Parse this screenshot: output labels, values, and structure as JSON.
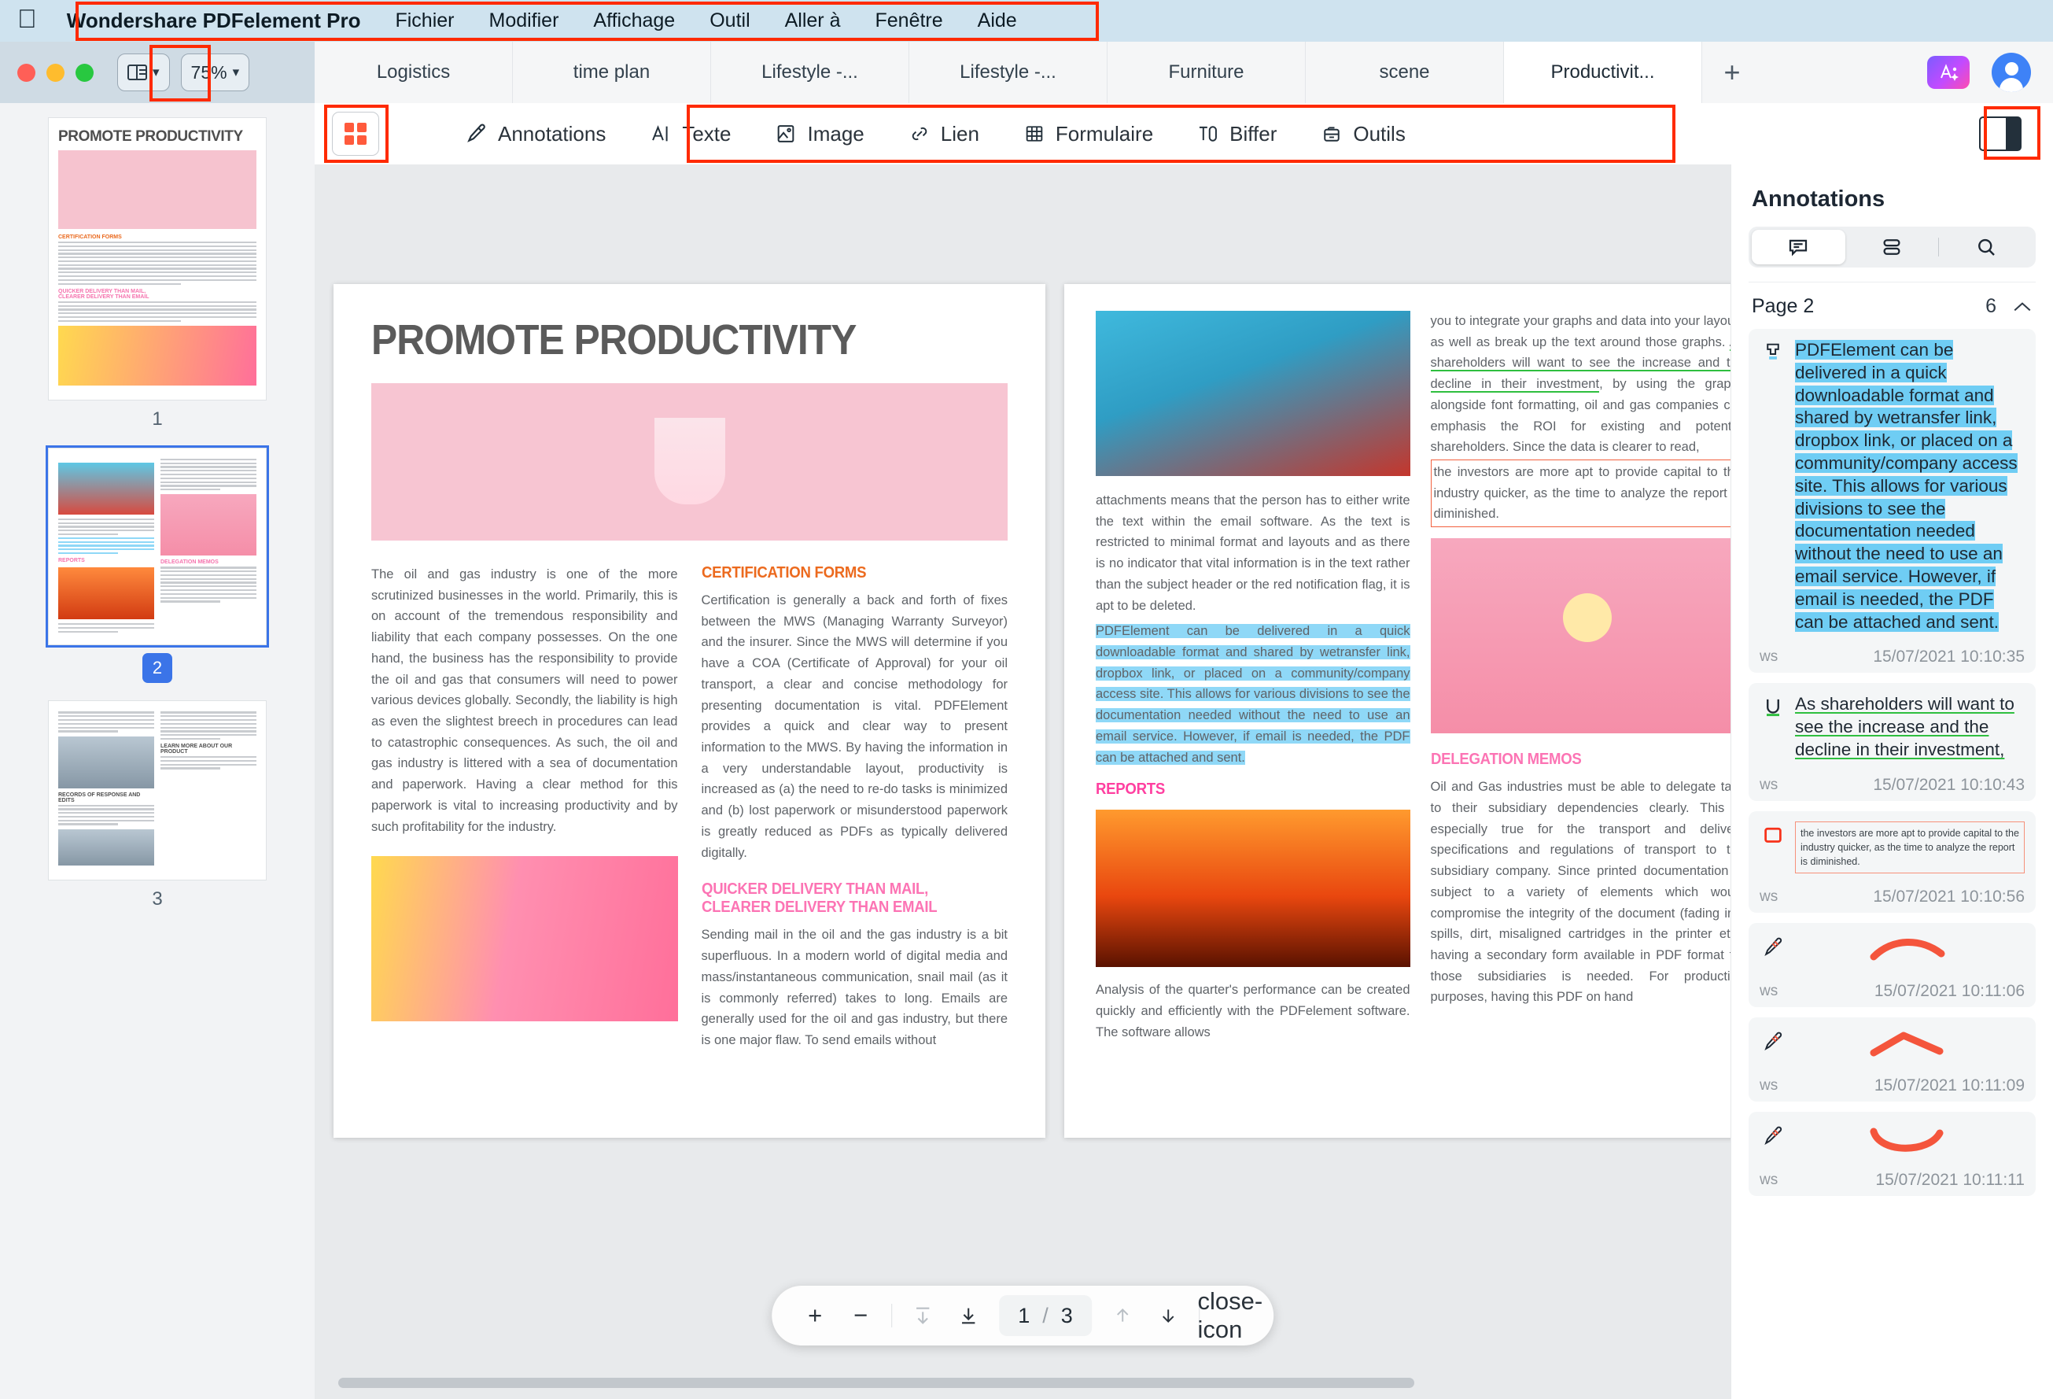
{
  "menubar": {
    "apple_icon": "apple-logo-icon",
    "items": [
      {
        "label": "Wondershare PDFelement Pro",
        "bold": true
      },
      {
        "label": "Fichier"
      },
      {
        "label": "Modifier"
      },
      {
        "label": "Affichage"
      },
      {
        "label": "Outil"
      },
      {
        "label": "Aller à"
      },
      {
        "label": "Fenêtre"
      },
      {
        "label": "Aide"
      }
    ]
  },
  "window": {
    "zoom_level": "75%",
    "view_toggle_icon": "sidebar-layout-icon",
    "traffic_lights": [
      "close-button",
      "minimize-button",
      "maximize-button"
    ]
  },
  "tabs": {
    "items": [
      {
        "label": "Logistics",
        "active": false
      },
      {
        "label": "time plan",
        "active": false
      },
      {
        "label": "Lifestyle -...",
        "active": false
      },
      {
        "label": "Lifestyle -...",
        "active": false
      },
      {
        "label": "Furniture",
        "active": false
      },
      {
        "label": "scene",
        "active": false
      },
      {
        "label": "Productivit...",
        "active": true
      }
    ],
    "new_tab_label": "+",
    "ai_badge_label": "AI"
  },
  "toolbar": {
    "grid_icon": "grid-view-icon",
    "right_panel_icon": "right-panel-icon",
    "tools": [
      {
        "label": "Annotations",
        "icon": "highlighter-pen-icon"
      },
      {
        "label": "Texte",
        "icon": "text-cursor-icon"
      },
      {
        "label": "Image",
        "icon": "image-icon"
      },
      {
        "label": "Lien",
        "icon": "link-icon"
      },
      {
        "label": "Formulaire",
        "icon": "form-grid-icon"
      },
      {
        "label": "Biffer",
        "icon": "redact-icon"
      },
      {
        "label": "Outils",
        "icon": "toolbox-icon"
      }
    ]
  },
  "thumbnails": {
    "pages": [
      {
        "number": "1",
        "selected": false,
        "title": "PROMOTE PRODUCTIVITY"
      },
      {
        "number": "2",
        "selected": true,
        "title": ""
      },
      {
        "number": "3",
        "selected": false,
        "title": ""
      }
    ]
  },
  "document": {
    "page1": {
      "title": "PROMOTE PRODUCTIVITY",
      "left_paragraph": "The oil and gas industry is one of the more scrutinized businesses in the world. Primarily, this is on account of the tremendous responsibility and liability that each company possesses. On the one hand, the business has the responsibility to provide the oil and gas that consumers will need to power various devices globally. Secondly, the liability is high as even the slightest breech in procedures can lead to catastrophic consequences. As such, the oil and gas industry is littered with a sea of documentation and paperwork. Having a clear method for this paperwork is vital to increasing productivity and by such profitability for the industry.",
      "sections": [
        {
          "heading": "CERTIFICATION FORMS",
          "color": "#ec6a1e",
          "body": "Certification is generally a back and forth of fixes between the MWS (Managing Warranty Surveyor) and the insurer. Since the MWS will determine if you have a COA (Certificate of Approval) for your oil transport, a clear and concise methodology for presenting documentation is vital. PDFElement provides a quick and clear way to present information to the MWS. By having the information in a very understandable layout, productivity is increased as (a) the need to re-do tasks is minimized and (b) lost paperwork or misunderstood paperwork is greatly reduced as PDFs as typically delivered digitally."
        },
        {
          "heading": "QUICKER  DELIVERY  THAN  MAIL, CLEARER DELIVERY THAN EMAIL",
          "color": "#fc74b4",
          "body": "Sending mail in the oil and the gas industry is a bit superfluous. In a modern world of digital media and mass/instantaneous communication, snail mail (as it is commonly referred) takes to long. Emails are generally used for the oil and gas industry, but there is one major flaw. To send emails without"
        }
      ]
    },
    "page2": {
      "col1_paragraph": "attachments means that the person has to either write the text within the email software. As the text is restricted to minimal format and layouts and as there is no indicator that vital information is in the text rather than the subject header or the red notification flag, it is apt to be deleted.",
      "col1_highlighted": "PDFElement can be delivered in a quick downloadable format and shared by wetransfer link, dropbox link, or placed on a community/company access site. This allows for various divisions to see the documentation needed without the need to use an email service. However, if email is needed, the PDF can be attached and sent.",
      "col1_heading": "REPORTS",
      "col1_after": "Analysis of the quarter's performance can be created quickly and efficiently with the PDFelement software. The software allows",
      "col2_lead": "you to integrate your graphs and data into your layouts as well as break up the text around those graphs. ",
      "col2_underlined": "As shareholders will want to see the increase and the decline in their investment",
      "col2_mid": ", by using the graphs alongside font formatting, oil and gas companies can emphasis the ROI for existing and potential shareholders. Since the data is clearer to read,",
      "col2_boxed": "the investors are more apt to provide capital to the industry quicker, as the time to analyze the report is diminished.",
      "col2_heading": "DELEGATION MEMOS",
      "col2_body": "Oil and Gas industries must be able to delegate task to their subsidiary dependencies clearly. This is especially true for the transport and delivery specifications and regulations of transport to the subsidiary company. Since printed documentation is subject to a variety of elements which would compromise the integrity of the document (fading ink, spills, dirt, misaligned cartridges in the printer etc.) having a secondary form available in PDF format for those subsidiaries is needed. For production purposes, having this PDF on hand"
    }
  },
  "annotations_panel": {
    "title": "Annotations",
    "segments": [
      {
        "icon": "comment-list-icon",
        "active": true
      },
      {
        "icon": "list-rows-icon",
        "active": false
      },
      {
        "icon": "search-icon",
        "active": false
      }
    ],
    "group": {
      "label": "Page 2",
      "count": "6",
      "collapse_icon": "chevron-up-icon"
    },
    "cards": [
      {
        "icon": "highlight-marker-icon",
        "type": "highlight",
        "text": "PDFElement can be delivered in a quick downloadable format and shared by wetransfer link, dropbox link, or placed on a community/company access site. This allows for various divisions to see the documentation needed without the need to use an email service. However, if email is needed, the PDF can be attached and sent.",
        "author": "ws",
        "timestamp": "15/07/2021 10:10:35"
      },
      {
        "icon": "underline-icon",
        "type": "underline",
        "text": "As shareholders will want to see the increase and the decline in their investment,",
        "author": "ws",
        "timestamp": "15/07/2021 10:10:43"
      },
      {
        "icon": "rectangle-icon",
        "type": "rectangle",
        "text": "the investors are more apt to provide capital to the industry quicker, as the time to analyze the report is diminished.",
        "author": "ws",
        "timestamp": "15/07/2021 10:10:56"
      },
      {
        "icon": "pencil-draw-icon",
        "type": "ink",
        "shape": "arc-down",
        "text": "",
        "author": "ws",
        "timestamp": "15/07/2021 10:11:06"
      },
      {
        "icon": "pencil-draw-icon",
        "type": "ink",
        "shape": "arc-peak",
        "text": "",
        "author": "ws",
        "timestamp": "15/07/2021 10:11:09"
      },
      {
        "icon": "pencil-draw-icon",
        "type": "ink",
        "shape": "arc-up",
        "text": "",
        "author": "ws",
        "timestamp": "15/07/2021 10:11:11"
      }
    ]
  },
  "pager": {
    "zoom_in": "+",
    "zoom_out": "−",
    "first_page_icon": "go-first-icon",
    "prev_block_icon": "go-down-icon",
    "current_page": "1",
    "separator": "/",
    "total_pages": "3",
    "up_icon": "arrow-up-icon",
    "down_icon": "arrow-down-icon",
    "close_icon": "close-icon"
  },
  "colors": {
    "menubar_bg": "#cfe3ef",
    "highlight_red": "#ff2a00",
    "accent_blue": "#3b74e8",
    "annotation_blue": "#6fcdf4",
    "annotation_green": "#2fbf3f",
    "annotation_red": "#f2603e"
  }
}
